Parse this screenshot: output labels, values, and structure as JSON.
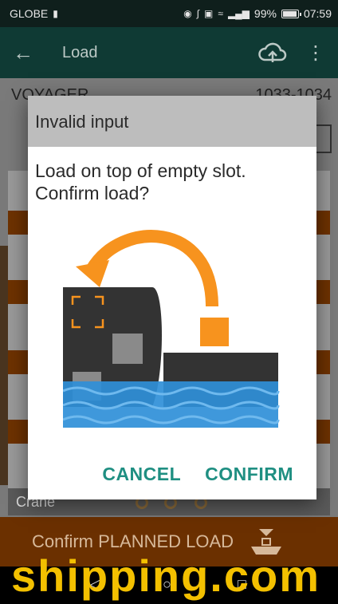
{
  "status_bar": {
    "carrier": "GLOBE",
    "battery_percent": "99%",
    "time": "07:59"
  },
  "app_bar": {
    "title": "Load"
  },
  "page": {
    "vessel_name": "VOYAGER",
    "vessel_code": "1033-1034",
    "crane_label": "Crane",
    "confirm_planned_load_label": "Confirm PLANNED LOAD"
  },
  "dialog": {
    "title": "Invalid input",
    "message": "Load on top of empty slot. Confirm load?",
    "cancel_label": "CANCEL",
    "confirm_label": "CONFIRM"
  },
  "colors": {
    "accent": "#1f8f82",
    "app_bar": "#0f3a34",
    "action_bar": "#6b3000",
    "container_orange": "#f7931e",
    "water_blue": "#2f8fd8"
  },
  "watermark": "shipping.com"
}
